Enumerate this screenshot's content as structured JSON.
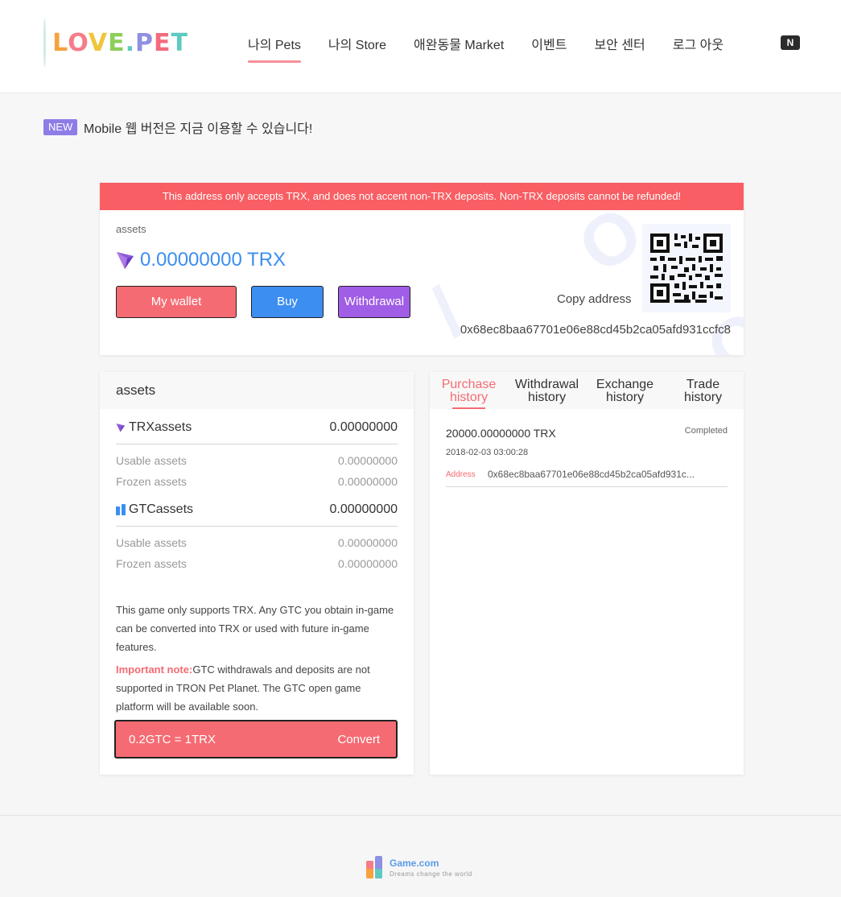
{
  "header": {
    "logo_text": "LOVE.PET",
    "nav": [
      {
        "label": "나의 Pets"
      },
      {
        "label": "나의 Store"
      },
      {
        "label": "애완동물 Market"
      },
      {
        "label": "이벤트"
      },
      {
        "label": "보안 센터"
      },
      {
        "label": "로그 아웃"
      }
    ],
    "badge": "N"
  },
  "notice": {
    "tag": "NEW",
    "text": "Mobile 웹 버전은 지금 이용할 수 있습니다!"
  },
  "wallet": {
    "warning": "This address only accepts TRX, and does not accent non-TRX deposits. Non-TRX deposits cannot be refunded!",
    "assets_label": "assets",
    "balance": "0.00000000 TRX",
    "buttons": {
      "my_wallet": "My wallet",
      "buy": "Buy",
      "withdrawal": "Withdrawal"
    },
    "copy_address": "Copy address",
    "address": "0x68ec8baa67701e06e88cd45b2ca05afd931ccfc8"
  },
  "assets": {
    "title": "assets",
    "trx": {
      "name": "TRXassets",
      "value": "0.00000000",
      "usable_label": "Usable assets",
      "usable": "0.00000000",
      "frozen_label": "Frozen assets",
      "frozen": "0.00000000"
    },
    "gtc": {
      "name": "GTCassets",
      "value": "0.00000000",
      "usable_label": "Usable assets",
      "usable": "0.00000000",
      "frozen_label": "Frozen assets",
      "frozen": "0.00000000"
    },
    "info": "This game only supports TRX. Any GTC you obtain in-game can be converted into TRX or used with future in-game features.",
    "important_label": "Important note:",
    "important_text": "GTC withdrawals and deposits are not supported in TRON Pet Planet. The GTC open game platform will be available soon.",
    "convert_rate": "0.2GTC = 1TRX",
    "convert_button": "Convert"
  },
  "history": {
    "tabs": [
      {
        "line1": "Purchase",
        "line2": "history"
      },
      {
        "line1": "Withdrawal",
        "line2": "history"
      },
      {
        "line1": "Exchange",
        "line2": "history"
      },
      {
        "line1": "Trade",
        "line2": "history"
      }
    ],
    "records": [
      {
        "amount": "20000.00000000 TRX",
        "status": "Completed",
        "date": "2018-02-03 03:00:28",
        "address_label": "Address",
        "address": "0x68ec8baa67701e06e88cd45b2ca05afd931c..."
      }
    ]
  },
  "footer": {
    "name": "Game.com",
    "slogan": "Dreams change the world"
  },
  "colors": {
    "accent_red": "#f56b73",
    "accent_blue": "#3c8ef0",
    "accent_purple": "#a05de6",
    "warning_bar": "#f85e63",
    "new_tag": "#8e7de6"
  }
}
